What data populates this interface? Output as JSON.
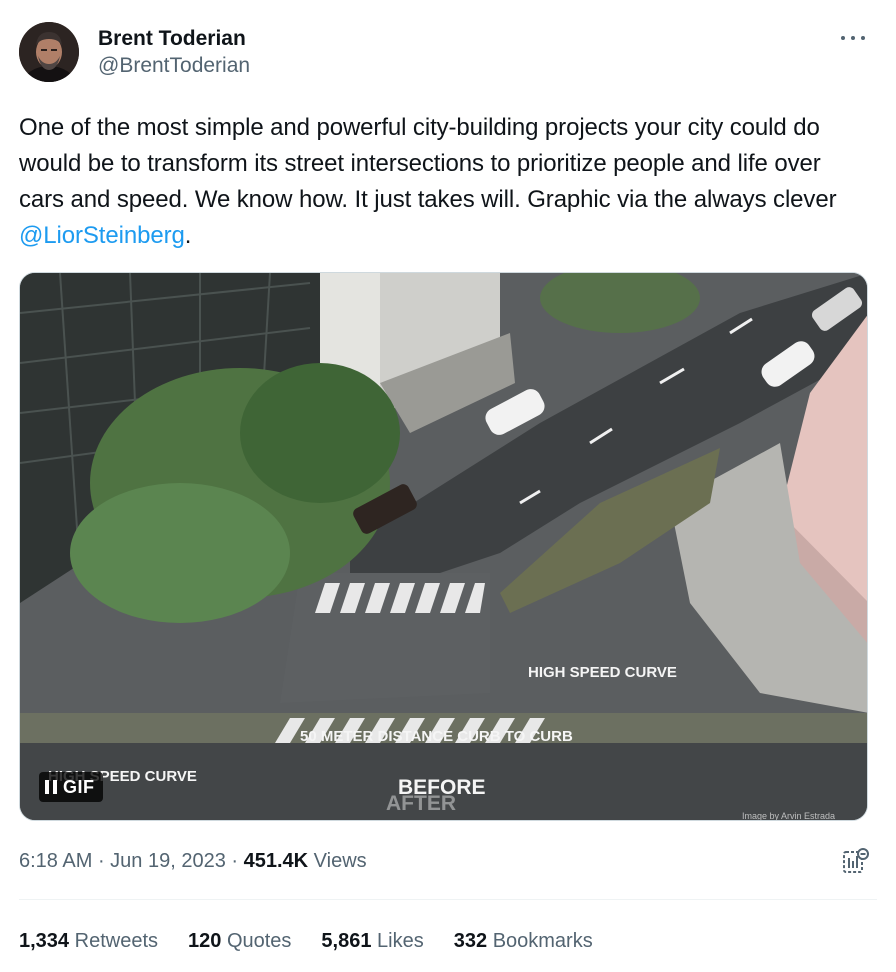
{
  "author": {
    "display_name": "Brent Toderian",
    "handle": "@BrentToderian"
  },
  "tweet": {
    "text_before_mention": "One of the most simple and powerful city-building projects your city could do would be to transform its street intersections to prioritize people and life over cars and speed. We know how. It just takes will. Graphic via the always clever ",
    "mention": "@LiorSteinberg",
    "text_after_mention": "."
  },
  "media": {
    "badge_label": "GIF",
    "image_text": {
      "high_speed_curve_right": "HIGH SPEED CURVE",
      "distance_label": "50 METER DISTANCE CURB TO CURB",
      "high_speed_curve_left": "HIGH SPEED CURVE",
      "before_label": "BEFORE",
      "after_label": "AFTER",
      "credit": "Image by Arvin Estrada"
    }
  },
  "meta": {
    "time": "6:18 AM",
    "date": "Jun 19, 2023",
    "views_count": "451.4K",
    "views_label": "Views"
  },
  "stats": {
    "retweets_count": "1,334",
    "retweets_label": "Retweets",
    "quotes_count": "120",
    "quotes_label": "Quotes",
    "likes_count": "5,861",
    "likes_label": "Likes",
    "bookmarks_count": "332",
    "bookmarks_label": "Bookmarks"
  },
  "icons": {
    "more": "more-icon",
    "pause": "pause-icon",
    "analytics": "analytics-icon"
  },
  "colors": {
    "link": "#1d9bf0",
    "secondary_text": "#536471",
    "primary_text": "#0f1419"
  }
}
